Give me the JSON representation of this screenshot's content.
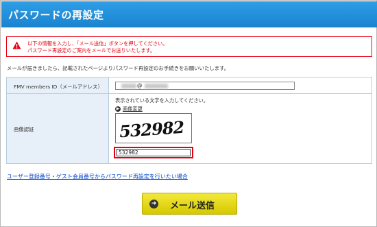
{
  "header": {
    "title": "パスワードの再設定"
  },
  "warning": {
    "line1": "以下の情報を入力し、「メール送信」ボタンを押してください。",
    "line2": "パスワード再設定のご案内をメールでお送りいたします。"
  },
  "info_text": "メールが届きましたら、記載されたページよりパスワード再設定のお手続きをお願いいたします。",
  "form": {
    "email_label": "FMV members ID（メールアドレス）",
    "email_value_at": "@",
    "captcha_label": "画像認証",
    "captcha_desc": "表示されている文字を入力してください。",
    "captcha_change": "画像変更",
    "captcha_image_text": "532982",
    "captcha_input_value": "532982"
  },
  "link_text": "ユーザー登録番号・ゲスト会員番号からパスワード再設定を行いたい場合",
  "submit": {
    "label": "メール送信"
  },
  "colors": {
    "header": "#1a83cf",
    "warning": "#e60012",
    "button": "#e6d91a",
    "link": "#0044cc"
  }
}
